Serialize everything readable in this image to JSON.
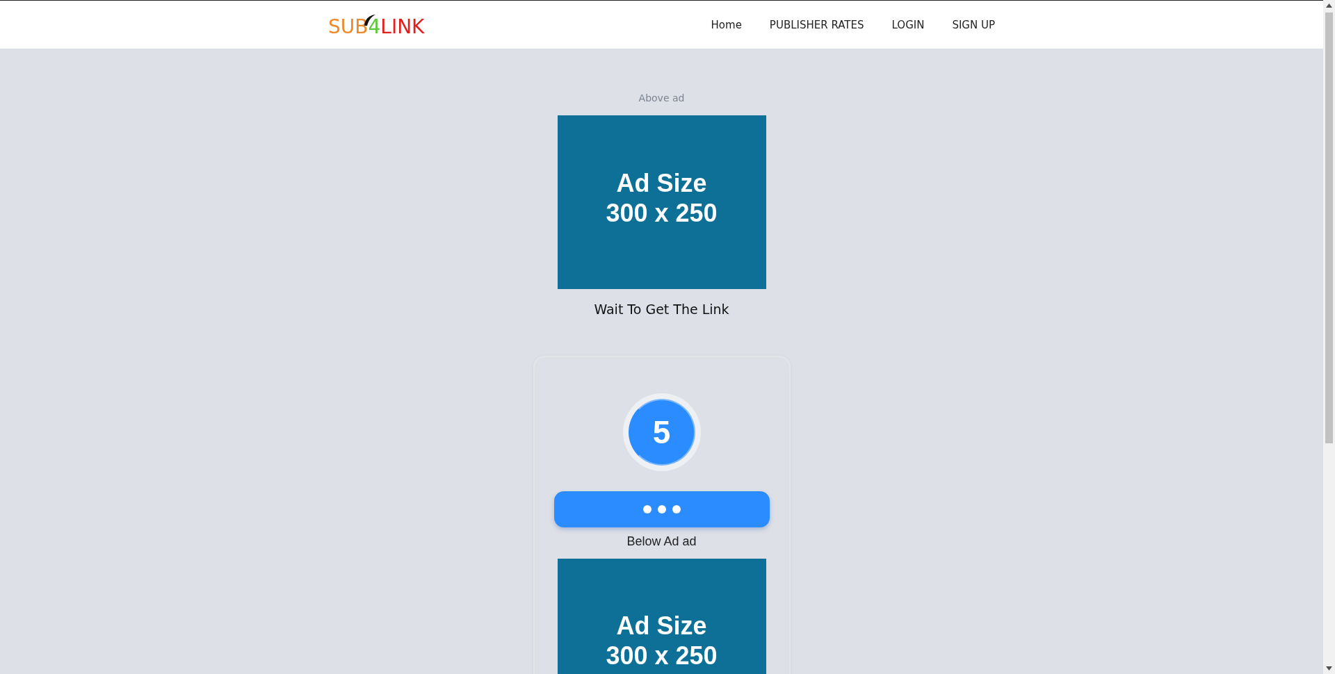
{
  "header": {
    "logo": [
      {
        "text": "SUB",
        "color": "#ec8a2c"
      },
      {
        "text": "4",
        "color": "#5cc93a"
      },
      {
        "text": "LINK",
        "color": "#e0201f"
      }
    ],
    "nav": [
      "Home",
      "PUBLISHER RATES",
      "LOGIN",
      "SIGN UP"
    ]
  },
  "top_ad": {
    "caption": "Above ad",
    "lines": [
      "Ad Size",
      "300 x 250"
    ]
  },
  "heading": "Wait To Get The Link",
  "card": {
    "countdown": "5",
    "button_busy": true,
    "caption": "Below Ad ad",
    "ad_lines": [
      "Ad Size",
      "300 x 250"
    ]
  }
}
